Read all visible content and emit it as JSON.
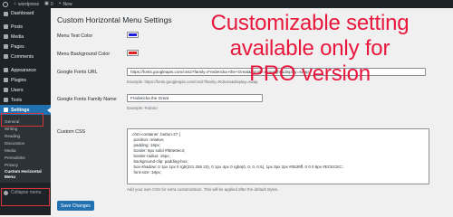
{
  "admin_bar": {
    "site_name": "wordpress",
    "comments_count": "0",
    "new_label": "New"
  },
  "sidebar": {
    "items": [
      {
        "label": "Dashboard"
      },
      {
        "label": "Posts"
      },
      {
        "label": "Media"
      },
      {
        "label": "Pages"
      },
      {
        "label": "Comments"
      },
      {
        "label": "Appearance"
      },
      {
        "label": "Plugins"
      },
      {
        "label": "Users"
      },
      {
        "label": "Tools"
      },
      {
        "label": "Settings"
      }
    ],
    "submenu": [
      {
        "label": "General"
      },
      {
        "label": "Writing"
      },
      {
        "label": "Reading"
      },
      {
        "label": "Discussion"
      },
      {
        "label": "Media"
      },
      {
        "label": "Permalinks"
      },
      {
        "label": "Privacy"
      },
      {
        "label": "Custom Horizontal Menu"
      }
    ],
    "collapse_label": "Collapse menu"
  },
  "page": {
    "title": "Custom Horizontal Menu Settings",
    "menu_text_color": {
      "label": "Menu Text Color",
      "color": "#1f1fe0"
    },
    "menu_bg_color": {
      "label": "Menu Background Color",
      "color": "#e01f1f"
    },
    "fonts_url": {
      "label": "Google Fonts URL",
      "value": "https://fonts.googleapis.com/css2?family=Fredericka+the+Great&family=Limelight&display=swap",
      "example": "Example: https://fonts.googleapis.com/css2?family=Roboto&display=swap"
    },
    "font_family": {
      "label": "Google Fonts Family Name",
      "value": "Fredericka the Great",
      "example": "Example: Roboto"
    },
    "custom_css": {
      "label": "Custom CSS",
      "lines": [
        ".chm-container .button-27 {",
        "  position: relative;",
        "  padding: 16px;",
        "  border: 6px solid #f60e0ec4;",
        "  border-radius: 16px;",
        "  background-clip: padding-box;",
        "  box-shadow: 0 1px 1px 0 rgb(221 255 22), 0 1px 4px 0 rgba(0, 0, 0, 0.5), 1px 3px 2px #0539ff, 0 0 0 6px #ECECEC;",
        "  font-size: 18px;"
      ],
      "hint": "Add your own CSS for extra customization. This will be applied after the default styles."
    },
    "save_label": "Save Changes"
  },
  "promo": {
    "text": "Customizable setting available only for PRO version"
  }
}
